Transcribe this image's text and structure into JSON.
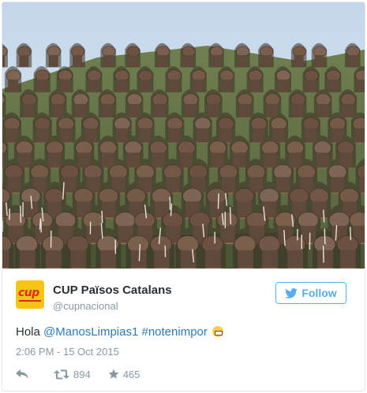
{
  "media": {
    "photo": "photo of a large crowd of warriors bending over on a grassy hillside with arrows stuck in the ground"
  },
  "author": {
    "avatar_icon": "cup-logo-icon",
    "avatar_text": "cup",
    "display_name": "CUP Països Catalans",
    "screen_name": "@cupnacional"
  },
  "follow_button": {
    "label": "Follow",
    "icon": "twitter-bird-icon",
    "color": "#55acee"
  },
  "tweet": {
    "text_start": "Hola ",
    "mention": "@ManosLimpias1",
    "hashtag": "#notenimpor",
    "emoji": "grimacing-face-icon",
    "timestamp": "2:06 PM - 15 Oct 2015"
  },
  "actions": {
    "reply_icon": "reply-icon",
    "retweet_icon": "retweet-icon",
    "retweet_count": "894",
    "favorite_icon": "star-icon",
    "favorite_count": "465"
  },
  "colors": {
    "link": "#2b7bb9",
    "muted": "#8899a6",
    "text": "#292f33",
    "accent": "#55acee",
    "brand_yellow": "#f6c416",
    "brand_red": "#e32a17"
  }
}
